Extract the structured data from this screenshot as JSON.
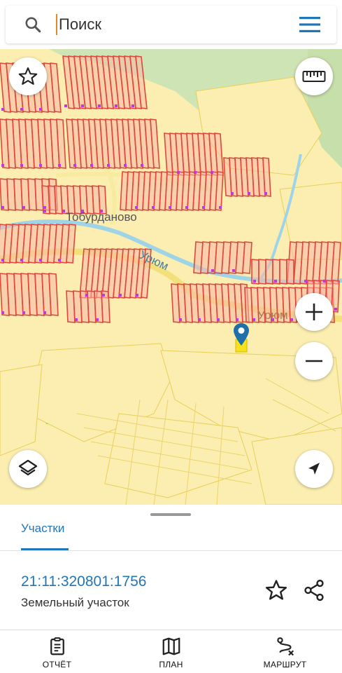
{
  "search": {
    "placeholder": "Поиск"
  },
  "map": {
    "labels": {
      "village": "Тобурданово",
      "river": "Урюм",
      "street": "Урюм"
    },
    "zoom_in_label": "+",
    "zoom_out_label": "−"
  },
  "sheet": {
    "tab_label": "Участки",
    "parcel_id": "21:11:320801:1756",
    "parcel_type": "Земельный участок"
  },
  "nav": {
    "report": "ОТЧЁТ",
    "plan": "ПЛАН",
    "route": "МАРШРУТ"
  },
  "colors": {
    "accent": "#2176b8",
    "parcel_stroke": "#e0473a",
    "parcel_fill": "#f6b8a8",
    "map_bg": "#fbeeb0",
    "forest": "#cfe4b4",
    "water": "#9fd4e8",
    "road": "#f4e07a",
    "marker": "#1f6fa8",
    "selected_parcel": "#f7e11a"
  },
  "icons": [
    "search-icon",
    "menu-icon",
    "star-icon",
    "ruler-icon",
    "zoom-in-icon",
    "zoom-out-icon",
    "layers-icon",
    "location-arrow-icon",
    "share-icon",
    "clipboard-icon",
    "map-icon",
    "route-icon",
    "map-pin-icon"
  ]
}
